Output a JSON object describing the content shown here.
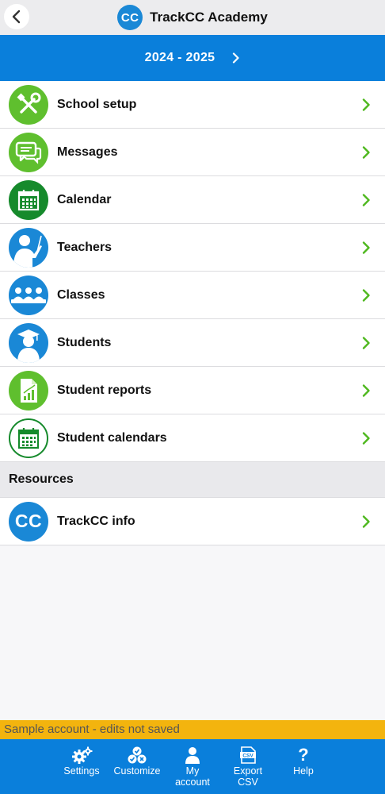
{
  "header": {
    "logo_text": "CC",
    "title": "TrackCC Academy",
    "back_icon": "chevron-left-icon"
  },
  "year_selector": {
    "label": "2024 - 2025",
    "icon": "chevron-right-icon"
  },
  "menu": {
    "items": [
      {
        "label": "School setup",
        "icon": "wrench-screwdriver-icon",
        "color": "#5fbf2e"
      },
      {
        "label": "Messages",
        "icon": "chat-bubbles-icon",
        "color": "#5fbf2e"
      },
      {
        "label": "Calendar",
        "icon": "calendar-icon",
        "color": "#168a2c"
      },
      {
        "label": "Teachers",
        "icon": "teacher-icon",
        "color": "#1a88d6"
      },
      {
        "label": "Classes",
        "icon": "classroom-icon",
        "color": "#1a88d6"
      },
      {
        "label": "Students",
        "icon": "graduate-icon",
        "color": "#1a88d6"
      },
      {
        "label": "Student reports",
        "icon": "report-chart-icon",
        "color": "#5fbf2e"
      },
      {
        "label": "Student calendars",
        "icon": "calendar-outline-icon",
        "color": "#168a2c"
      }
    ]
  },
  "resources": {
    "header": "Resources",
    "items": [
      {
        "label": "TrackCC info",
        "icon_text": "CC",
        "icon": "trackcc-logo-icon",
        "color": "#1a88d6"
      }
    ]
  },
  "banner": {
    "text": "Sample account - edits not saved",
    "color": "#f3b40e"
  },
  "tabbar": {
    "tabs": [
      {
        "label_line1": "Settings",
        "label_line2": "",
        "icon": "gears-icon"
      },
      {
        "label_line1": "Customize",
        "label_line2": "",
        "icon": "customize-icon"
      },
      {
        "label_line1": "My",
        "label_line2": "account",
        "icon": "person-icon"
      },
      {
        "label_line1": "Export",
        "label_line2": "CSV",
        "icon": "csv-file-icon"
      },
      {
        "label_line1": "Help",
        "label_line2": "",
        "icon": "question-mark-icon"
      }
    ]
  },
  "colors": {
    "primary_blue": "#0a7fdb",
    "chevron_green": "#4fb81f"
  }
}
